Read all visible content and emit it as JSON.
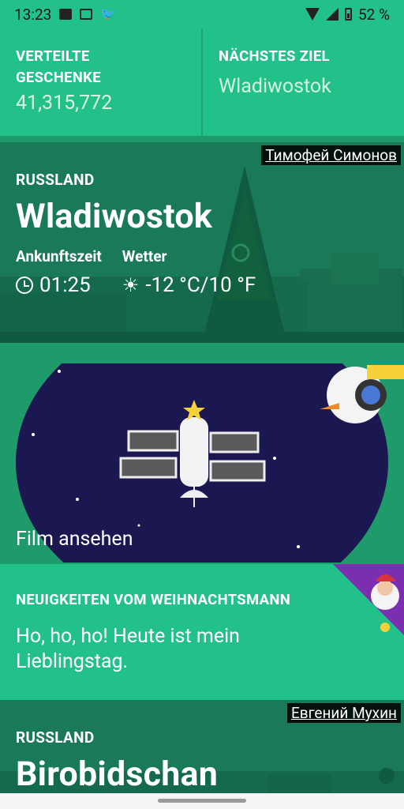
{
  "status_bar": {
    "time": "13:23",
    "battery": "52 %",
    "icons": [
      "photo-icon",
      "mail-icon",
      "twitter-icon",
      "wifi-icon",
      "signal-icon",
      "battery-icon"
    ]
  },
  "stats": {
    "delivered_label": "VERTEILTE GESCHENKE",
    "delivered_value": "41,315,772",
    "next_label": "NÄCHSTES ZIEL",
    "next_value": "Wladiwostok"
  },
  "current_city": {
    "photo_credit": "Тимофей Симонов",
    "country": "RUSSLAND",
    "name": "Wladiwostok",
    "arrival_label": "Ankunftszeit",
    "arrival_value": "01:25",
    "weather_label": "Wetter",
    "weather_value": "-12 °C/10 °F"
  },
  "film": {
    "label": "Film ansehen"
  },
  "news": {
    "title": "NEUIGKEITEN VOM WEIHNACHTSMANN",
    "text": "Ho, ho, ho! Heute ist mein Lieblingstag."
  },
  "next_city": {
    "photo_credit": "Евгений Мухин",
    "country": "RUSSLAND",
    "name": "Birobidschan"
  },
  "colors": {
    "accent": "#22c18a",
    "dark_green": "#187a58",
    "space": "#1b1750"
  }
}
